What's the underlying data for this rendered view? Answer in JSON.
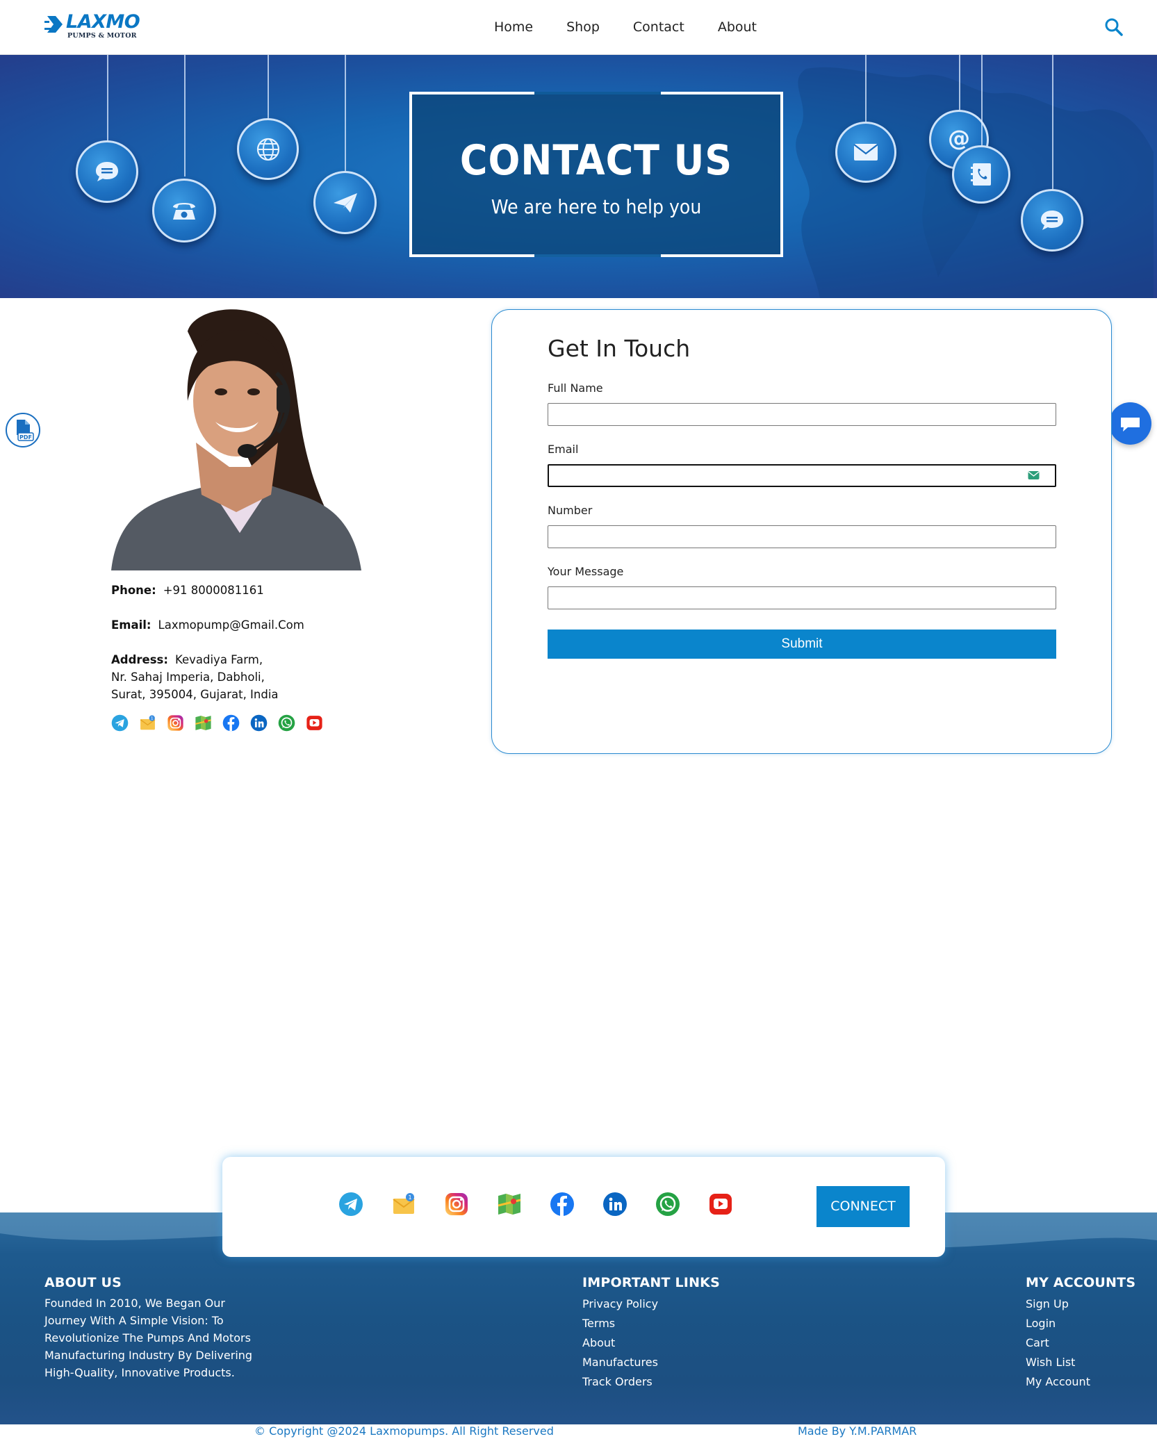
{
  "header": {
    "logo_brand": "LAXMO",
    "logo_tagline": "PUMPS & MOTOR",
    "nav": [
      "Home",
      "Shop",
      "Contact",
      "About"
    ]
  },
  "banner": {
    "title": "CONTACT US",
    "subtitle": "We are here to help you"
  },
  "contact": {
    "phone_label": "Phone:",
    "phone": "+91 8000081161",
    "email_label": "Email:",
    "email": "Laxmopump@Gmail.Com",
    "address_label": "Address:",
    "address_line1": "Kevadiya Farm,",
    "address_line2": "Nr. Sahaj Imperia, Dabholi,",
    "address_line3": "Surat, 395004, Gujarat, India"
  },
  "social_icons": [
    "telegram-icon",
    "mail-icon",
    "instagram-icon",
    "maps-icon",
    "facebook-icon",
    "linkedin-icon",
    "whatsapp-icon",
    "youtube-icon"
  ],
  "form": {
    "title": "Get In Touch",
    "fields": [
      {
        "label": "Full Name",
        "value": ""
      },
      {
        "label": "Email",
        "value": ""
      },
      {
        "label": "Number",
        "value": ""
      },
      {
        "label": "Your Message",
        "value": ""
      }
    ],
    "submit_label": "Submit"
  },
  "footer": {
    "connect_label": "CONNECT",
    "about_title": "ABOUT US",
    "about_lines": [
      "Founded In 2010, We Began Our",
      "Journey With A Simple Vision: To",
      "Revolutionize The Pumps And Motors",
      "Manufacturing Industry By Delivering",
      "High-Quality, Innovative Products."
    ],
    "links_title": "IMPORTANT LINKS",
    "links": [
      "Privacy Policy",
      "Terms",
      "About",
      "Manufactures",
      "Track Orders"
    ],
    "accounts_title": "MY ACCOUNTS",
    "accounts": [
      "Sign Up",
      "Login",
      "Cart",
      "Wish List",
      "My Account"
    ],
    "copyright": "© Copyright @2024 Laxmopumps. All Right Reserved",
    "made_by": "Made By Y.M.PARMAR"
  },
  "colors": {
    "brand_blue": "#0a85cc",
    "banner_blue": "#1766b2",
    "chat_blue": "#1f6fe0"
  }
}
